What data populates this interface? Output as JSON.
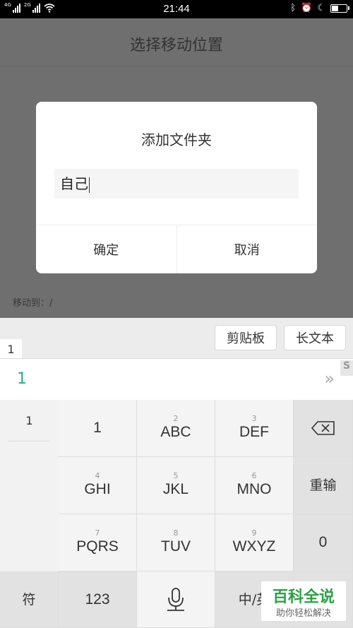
{
  "status_bar": {
    "time": "21:44",
    "signal1_label": "4G",
    "signal2_label": "2G",
    "battery_percent": 45
  },
  "page": {
    "title": "选择移动位置",
    "move_to_label": "移动到：/"
  },
  "dialog": {
    "title": "添加文件夹",
    "input_value": "自己",
    "confirm_label": "确定",
    "cancel_label": "取消"
  },
  "keyboard": {
    "toolbar": {
      "clipboard_label": "剪贴板",
      "long_text_label": "长文本"
    },
    "pinyin": "1",
    "candidate": "1",
    "left_column_item": "1",
    "keys": {
      "k1": {
        "num": "",
        "label": "1"
      },
      "k2": {
        "num": "2",
        "label": "ABC"
      },
      "k3": {
        "num": "3",
        "label": "DEF"
      },
      "k4": {
        "num": "4",
        "label": "GHI"
      },
      "k5": {
        "num": "5",
        "label": "JKL"
      },
      "k6": {
        "num": "6",
        "label": "MNO"
      },
      "k7": {
        "num": "7",
        "label": "PQRS"
      },
      "k8": {
        "num": "8",
        "label": "TUV"
      },
      "k9": {
        "num": "9",
        "label": "WXYZ"
      },
      "reenter": "重输",
      "zero": "0",
      "symbol": "符",
      "num123": "123",
      "lang": "中/英"
    }
  },
  "watermark": {
    "brand": "百科全说",
    "slogan": "助你轻松解决"
  }
}
